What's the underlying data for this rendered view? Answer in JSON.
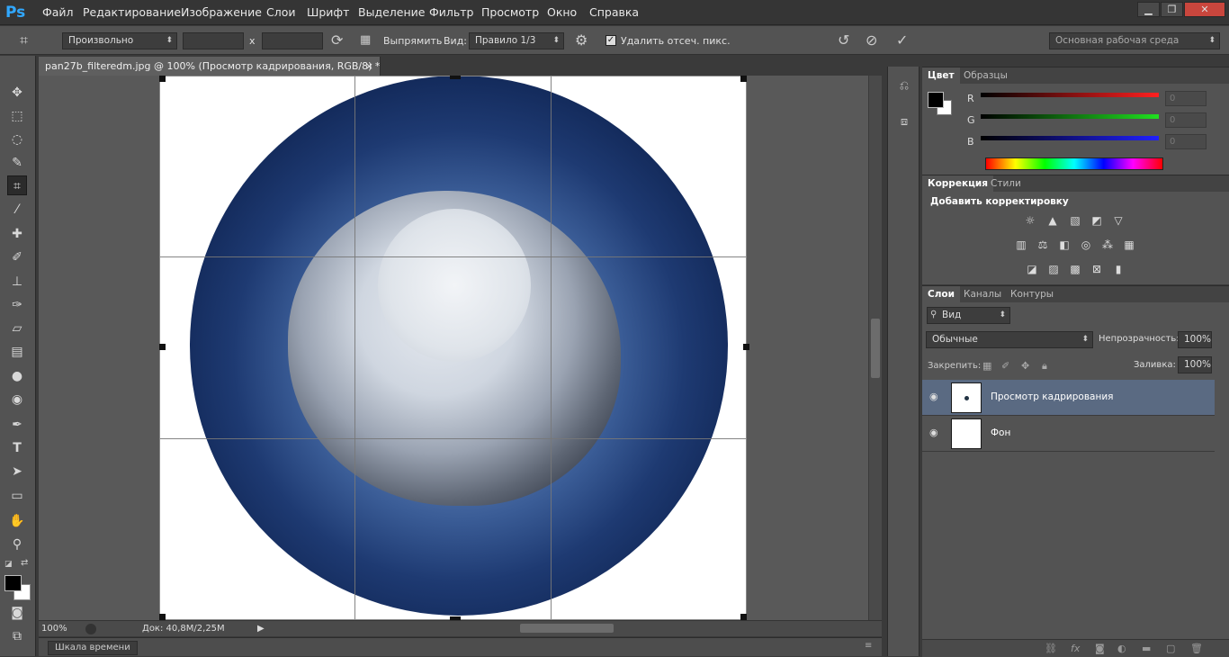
{
  "app": {
    "logo": "Ps"
  },
  "menu": [
    "Файл",
    "Редактирование",
    "Изображение",
    "Слои",
    "Шрифт",
    "Выделение",
    "Фильтр",
    "Просмотр",
    "Окно",
    "Справка"
  ],
  "window_controls": {
    "minimize": "▁",
    "restore": "❐",
    "close": "✕"
  },
  "options": {
    "ratio": "Произвольно",
    "x_sep": "x",
    "straighten": "Выпрямить",
    "view_label": "Вид:",
    "view_value": "Правило 1/3",
    "delete_cropped": "Удалить отсеч. пикс.",
    "workspace": "Основная рабочая среда"
  },
  "document": {
    "tab_title": "pan27b_filteredm.jpg @ 100% (Просмотр кадрирования, RGB/8) *",
    "close": "×",
    "zoom": "100%",
    "doc_info": "Док: 40,8M/2,25M"
  },
  "timeline": {
    "label": "Шкала времени"
  },
  "color_panel": {
    "tabs": [
      "Цвет",
      "Образцы"
    ],
    "channels": [
      {
        "label": "R",
        "value": "0",
        "color": "#ff2020"
      },
      {
        "label": "G",
        "value": "0",
        "color": "#20e020"
      },
      {
        "label": "B",
        "value": "0",
        "color": "#2020ff"
      }
    ]
  },
  "adjust_panel": {
    "tabs": [
      "Коррекция",
      "Стили"
    ],
    "title": "Добавить корректировку"
  },
  "layers_panel": {
    "tabs": [
      "Слои",
      "Каналы",
      "Контуры"
    ],
    "filter": "Вид",
    "blend": "Обычные",
    "opacity_label": "Непрозрачность:",
    "opacity": "100%",
    "lock_label": "Закрепить:",
    "fill_label": "Заливка:",
    "fill": "100%",
    "layers": [
      {
        "name": "Просмотр кадрирования",
        "selected": true
      },
      {
        "name": "Фон",
        "selected": false
      }
    ]
  },
  "colors": {
    "accent": "#31a8ff",
    "selected_layer": "#5a6a82",
    "arrow": "#e0191f"
  }
}
